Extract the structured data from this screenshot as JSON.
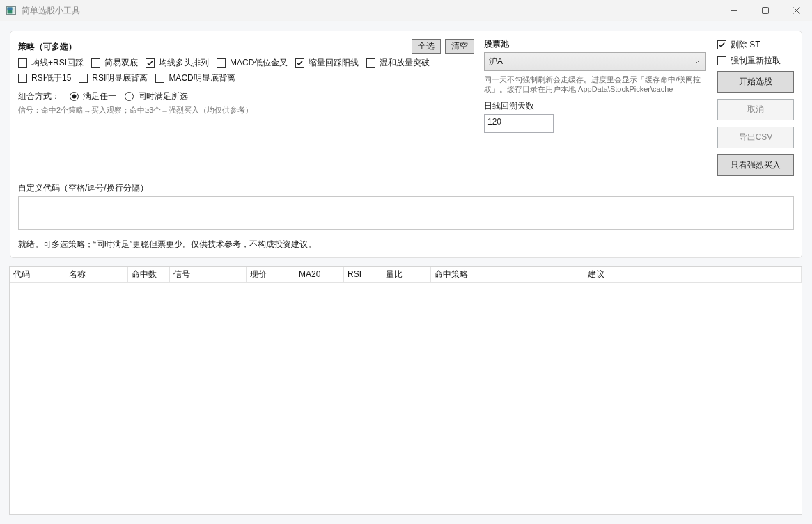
{
  "window": {
    "title": "简单选股小工具"
  },
  "strategy": {
    "title": "策略（可多选）",
    "buttons": [
      "全选",
      "清空"
    ],
    "options": [
      {
        "label": "均线+RSI回踩",
        "checked": false
      },
      {
        "label": "简易双底",
        "checked": false
      },
      {
        "label": "均线多头排列",
        "checked": true
      },
      {
        "label": "MACD低位金叉",
        "checked": false
      },
      {
        "label": "缩量回踩阳线",
        "checked": true
      },
      {
        "label": "温和放量突破",
        "checked": false
      },
      {
        "label": "RSI低于15",
        "checked": false
      },
      {
        "label": "RSI明显底背离",
        "checked": false
      },
      {
        "label": "MACD明显底背离",
        "checked": false
      }
    ],
    "combine": {
      "label": "组合方式：",
      "options": [
        {
          "label": "满足任一",
          "selected": true
        },
        {
          "label": "同时满足所选",
          "selected": false
        }
      ]
    },
    "signal_note": "信号：命中2个策略→买入观察；命中≥3个→强烈买入（均仅供参考）"
  },
  "stock_pool": {
    "label": "股票池",
    "value": "沪A",
    "note": "同一天不勾强制刷新会走缓存。进度里会显示「缓存命中/联网拉取」。缓存目录在用户本地 AppData\\StockPicker\\cache"
  },
  "lookback": {
    "label": "日线回溯天数",
    "value": "120"
  },
  "options": [
    {
      "label": "剔除 ST",
      "checked": true
    },
    {
      "label": "强制重新拉取",
      "checked": false
    }
  ],
  "actions": [
    {
      "label": "开始选股",
      "disabled": false
    },
    {
      "label": "取消",
      "disabled": true
    },
    {
      "label": "导出CSV",
      "disabled": true
    },
    {
      "label": "只看强烈买入",
      "disabled": false
    }
  ],
  "custom_codes": {
    "label": "自定义代码（空格/逗号/换行分隔）"
  },
  "status": "就绪。可多选策略；“同时满足”更稳但票更少。仅供技术参考，不构成投资建议。",
  "table": {
    "columns": [
      "代码",
      "名称",
      "命中数",
      "信号",
      "现价",
      "MA20",
      "RSI",
      "量比",
      "命中策略",
      "建议"
    ]
  }
}
